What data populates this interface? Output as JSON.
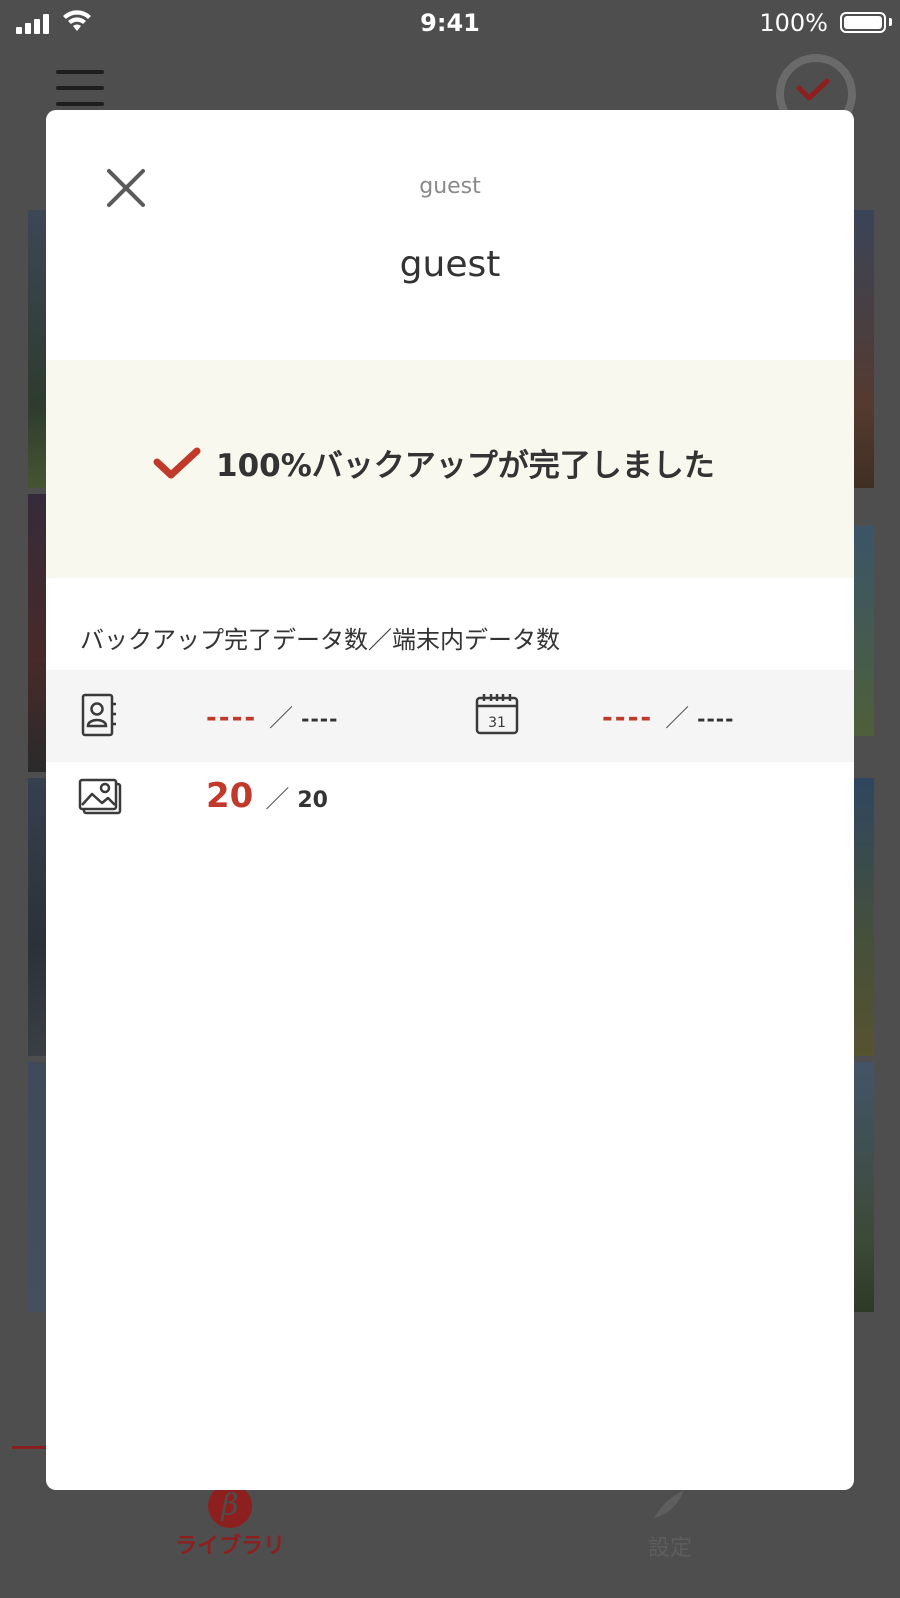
{
  "status_bar": {
    "time": "9:41",
    "battery_percent": "100%",
    "signal_bars": 4,
    "icons": [
      "signal-icon",
      "wifi-icon",
      "battery-icon"
    ]
  },
  "background_app": {
    "menu_icon": "hamburger-menu-icon",
    "sync_icon": "backup-complete-icon",
    "tabs": [
      {
        "label": "ライブラリ",
        "icon": "library-beta-icon",
        "selected": true
      },
      {
        "label": "設定",
        "icon": "settings-icon",
        "selected": false
      }
    ]
  },
  "modal": {
    "close_icon": "close-icon",
    "subtitle": "guest",
    "title": "guest",
    "status": {
      "icon": "checkmark-icon",
      "message": "100%バックアップが完了しました"
    },
    "counts_heading": "バックアップ完了データ数／端末内データ数",
    "separator": "／",
    "stats": [
      {
        "icon": "contacts-icon",
        "done": "----",
        "total": "----"
      },
      {
        "icon": "calendar-icon",
        "icon_text": "31",
        "done": "----",
        "total": "----"
      },
      {
        "icon": "photos-icon",
        "done": "20",
        "total": "20"
      }
    ]
  },
  "colors": {
    "accent_red": "#c0392b",
    "status_panel_bg": "#f8f8ef",
    "row_alt_bg": "#f5f5f5",
    "overlay_bg": "#4e4e4e"
  }
}
